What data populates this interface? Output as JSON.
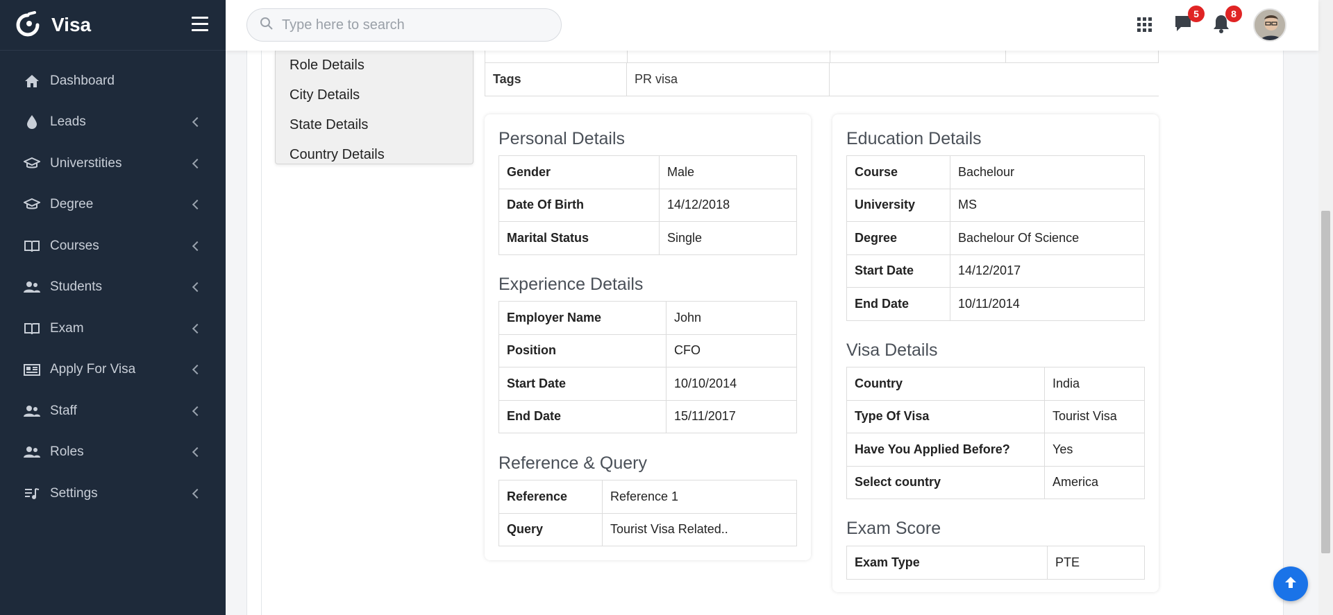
{
  "app": {
    "title": "Visa"
  },
  "sidebar": {
    "items": [
      {
        "label": "Dashboard",
        "icon": "home-icon",
        "has_submenu": false
      },
      {
        "label": "Leads",
        "icon": "droplet-icon",
        "has_submenu": true
      },
      {
        "label": "Universtities",
        "icon": "graduation-cap-icon",
        "has_submenu": true
      },
      {
        "label": "Degree",
        "icon": "graduation-cap-icon",
        "has_submenu": true
      },
      {
        "label": "Courses",
        "icon": "book-open-icon",
        "has_submenu": true
      },
      {
        "label": "Students",
        "icon": "users-icon",
        "has_submenu": true
      },
      {
        "label": "Exam",
        "icon": "book-open-icon",
        "has_submenu": true
      },
      {
        "label": "Apply For Visa",
        "icon": "newspaper-icon",
        "has_submenu": true
      },
      {
        "label": "Staff",
        "icon": "users-icon",
        "has_submenu": true
      },
      {
        "label": "Roles",
        "icon": "users-icon",
        "has_submenu": true
      },
      {
        "label": "Settings",
        "icon": "list-music-icon",
        "has_submenu": true
      }
    ]
  },
  "topbar": {
    "search_placeholder": "Type here to search",
    "messages_count": "5",
    "notifications_count": "8"
  },
  "side_menu": [
    "Role Details",
    "City Details",
    "State Details",
    "Country Details"
  ],
  "tags": {
    "label": "Tags",
    "value": "PR visa"
  },
  "personal": {
    "title": "Personal Details",
    "rows": [
      {
        "k": "Gender",
        "v": "Male"
      },
      {
        "k": "Date Of Birth",
        "v": "14/12/2018"
      },
      {
        "k": "Marital Status",
        "v": "Single"
      }
    ]
  },
  "experience": {
    "title": "Experience Details",
    "rows": [
      {
        "k": "Employer Name",
        "v": "John"
      },
      {
        "k": "Position",
        "v": "CFO"
      },
      {
        "k": "Start Date",
        "v": "10/10/2014"
      },
      {
        "k": "End Date",
        "v": "15/11/2017"
      }
    ]
  },
  "reference": {
    "title": "Reference & Query",
    "rows": [
      {
        "k": "Reference",
        "v": "Reference 1"
      },
      {
        "k": "Query",
        "v": "Tourist Visa Related.."
      }
    ]
  },
  "education": {
    "title": "Education Details",
    "rows": [
      {
        "k": "Course",
        "v": "Bachelour"
      },
      {
        "k": "University",
        "v": "MS"
      },
      {
        "k": "Degree",
        "v": "Bachelour Of Science"
      },
      {
        "k": "Start Date",
        "v": "14/12/2017"
      },
      {
        "k": "End Date",
        "v": "10/11/2014"
      }
    ]
  },
  "visa": {
    "title": "Visa Details",
    "rows": [
      {
        "k": "Country",
        "v": "India"
      },
      {
        "k": "Type Of Visa",
        "v": "Tourist Visa"
      },
      {
        "k": "Have You Applied Before?",
        "v": "Yes"
      },
      {
        "k": "Select country",
        "v": "America"
      }
    ]
  },
  "exam": {
    "title": "Exam Score",
    "rows": [
      {
        "k": "Exam Type",
        "v": "PTE"
      }
    ]
  },
  "colors": {
    "sidebar_bg": "#1e2a3a",
    "accent": "#1a73e8",
    "badge": "#e02424"
  }
}
